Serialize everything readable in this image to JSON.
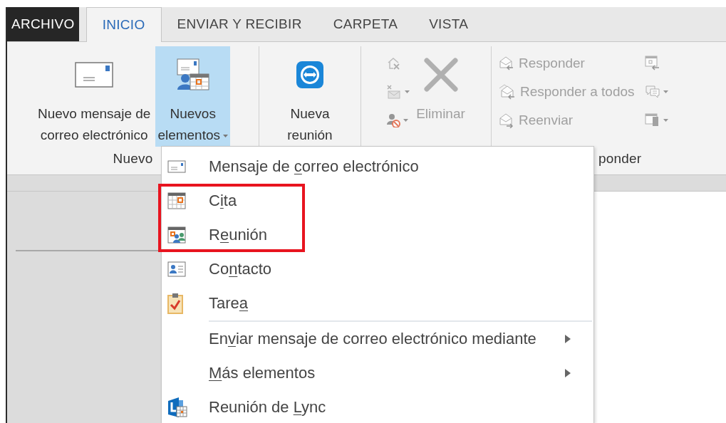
{
  "tabs": [
    {
      "label": "ARCHIVO",
      "kind": "backstage",
      "selected": false
    },
    {
      "label": "INICIO",
      "kind": "tab",
      "selected": true
    },
    {
      "label": "ENVIAR Y RECIBIR",
      "kind": "tab",
      "selected": false
    },
    {
      "label": "CARPETA",
      "kind": "tab",
      "selected": false
    },
    {
      "label": "VISTA",
      "kind": "tab",
      "selected": false
    }
  ],
  "ribbon": {
    "groups": [
      {
        "label": "Nuevo",
        "buttons": [
          {
            "kind": "large",
            "label_lines": [
              "Nuevo mensaje de",
              "correo electrónico"
            ],
            "pressed": false,
            "dropdown": false,
            "disabled": false
          },
          {
            "kind": "large",
            "label_lines": [
              "Nuevos",
              "elementos"
            ],
            "pressed": true,
            "dropdown": true,
            "disabled": false
          }
        ]
      },
      {
        "buttons": [
          {
            "kind": "large",
            "label_lines": [
              "Nueva",
              "reunión"
            ],
            "pressed": false,
            "dropdown": false,
            "disabled": false
          }
        ]
      },
      {
        "buttons": [
          {
            "kind": "icon",
            "dropdown": false,
            "disabled": true
          },
          {
            "kind": "icon",
            "dropdown": true,
            "disabled": true
          },
          {
            "kind": "icon",
            "dropdown": true,
            "disabled": true
          },
          {
            "kind": "large",
            "label_lines": [
              "Eliminar"
            ],
            "pressed": false,
            "dropdown": false,
            "disabled": true
          }
        ]
      },
      {
        "label": "ponder",
        "buttons": [
          {
            "kind": "small",
            "label": "Responder",
            "dropdown": false,
            "disabled": true
          },
          {
            "kind": "small",
            "label": "Responder a todos",
            "dropdown": false,
            "disabled": true
          },
          {
            "kind": "small",
            "label": "Reenviar",
            "dropdown": false,
            "disabled": true
          },
          {
            "kind": "icon",
            "dropdown": false,
            "disabled": true
          },
          {
            "kind": "icon",
            "dropdown": true,
            "disabled": true
          },
          {
            "kind": "icon",
            "dropdown": true,
            "disabled": true
          }
        ]
      }
    ]
  },
  "menu": {
    "items": [
      {
        "label_parts": {
          "before": "Mensaje de ",
          "key": "c",
          "after": "orreo electrónico"
        },
        "has_submenu": false,
        "highlighted": false,
        "separator_after": false
      },
      {
        "label_parts": {
          "before": "C",
          "key": "i",
          "after": "ta"
        },
        "has_submenu": false,
        "highlighted": true,
        "separator_after": false
      },
      {
        "label_parts": {
          "before": "R",
          "key": "e",
          "after": "unión"
        },
        "has_submenu": false,
        "highlighted": true,
        "separator_after": false
      },
      {
        "label_parts": {
          "before": "Co",
          "key": "n",
          "after": "tacto"
        },
        "has_submenu": false,
        "highlighted": false,
        "separator_after": false
      },
      {
        "label_parts": {
          "before": "Tare",
          "key": "a"
        },
        "has_submenu": false,
        "highlighted": false,
        "separator_after": true
      },
      {
        "label_parts": {
          "before": "En",
          "key": "v",
          "after": "iar mensaje de correo electrónico mediante"
        },
        "has_submenu": true,
        "highlighted": false,
        "separator_after": false
      },
      {
        "label_parts": {
          "key": "M",
          "after": "ás elementos"
        },
        "has_submenu": true,
        "highlighted": false,
        "separator_after": false
      },
      {
        "label_parts": {
          "before": "Reunión de ",
          "key": "L",
          "after": "ync"
        },
        "has_submenu": false,
        "highlighted": false,
        "separator_after": false
      }
    ]
  }
}
